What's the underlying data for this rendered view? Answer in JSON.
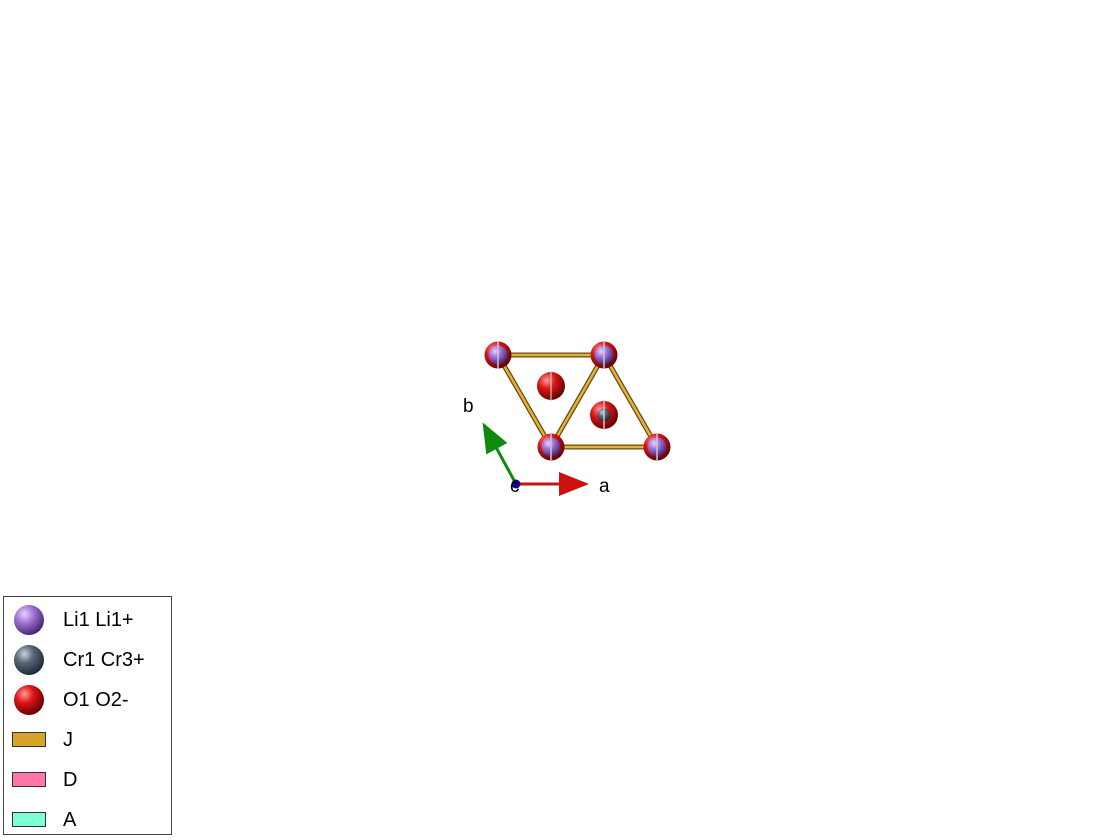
{
  "axes": {
    "a": "a",
    "b": "b",
    "c": "c"
  },
  "colors": {
    "li": "#9b6bc8",
    "cr": "#4a5565",
    "o": "#cc1111",
    "bond_J": "#d9a22b",
    "bond_D": "#ff77aa",
    "bond_A": "#7fffd4",
    "axis_a": "#cc1111",
    "axis_b": "#0f8a0f",
    "axis_c": "#0a0a8a"
  },
  "legend": {
    "items": [
      {
        "kind": "sphere",
        "label": "Li1 Li1+",
        "color": "#9b6bc8",
        "icon": "li-sphere-icon"
      },
      {
        "kind": "sphere",
        "label": "Cr1 Cr3+",
        "color": "#4a5565",
        "icon": "cr-sphere-icon"
      },
      {
        "kind": "sphere",
        "label": "O1 O2-",
        "color": "#cc1111",
        "icon": "o-sphere-icon"
      },
      {
        "kind": "bond",
        "label": "J",
        "color": "#d9a22b",
        "icon": "bond-j-swatch"
      },
      {
        "kind": "bond",
        "label": "D",
        "color": "#ff77aa",
        "icon": "bond-d-swatch"
      },
      {
        "kind": "bond",
        "label": "A",
        "color": "#7fffd4",
        "icon": "bond-a-swatch"
      }
    ]
  }
}
